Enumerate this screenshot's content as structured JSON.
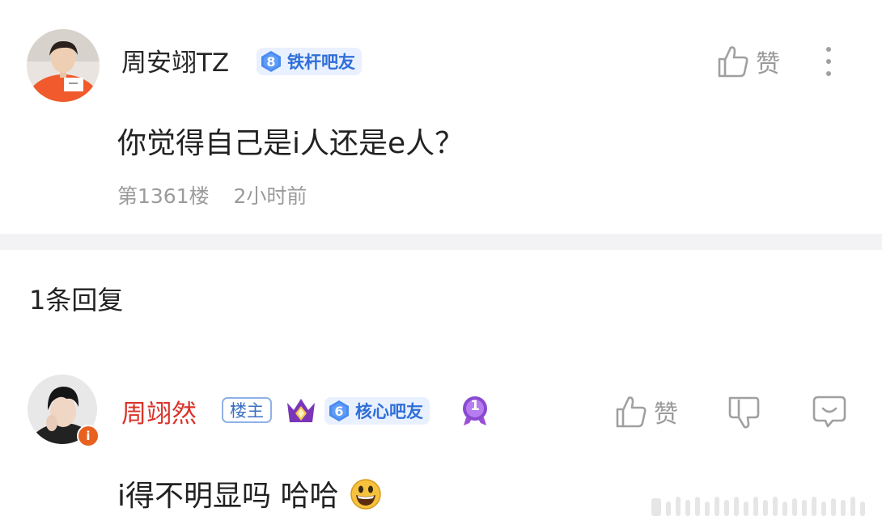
{
  "post": {
    "user": "周安翊TZ",
    "level": "8",
    "badge": "铁杆吧友",
    "like_label": "赞",
    "text": "你觉得自己是i人还是e人？",
    "floor": "第1361楼",
    "time": "2小时前"
  },
  "replies": {
    "count_label": "1条回复",
    "items": [
      {
        "user": "周翊然",
        "owner_tag": "楼主",
        "level": "6",
        "badge": "核心吧友",
        "achievement_number": "1",
        "like_label": "赞",
        "text": "i得不明显吗 哈哈"
      }
    ]
  },
  "colors": {
    "reply_name": "#d9332a",
    "level_blue": "#2f6fd8",
    "badge_bg": "#e9f0ff",
    "divider": "#f3f3f5"
  },
  "icons": [
    "thumbs-up-icon",
    "more-vertical-icon",
    "thumbs-down-icon",
    "comment-icon",
    "crown-icon",
    "medal-icon",
    "smile-emoji-icon",
    "verified-icon"
  ]
}
